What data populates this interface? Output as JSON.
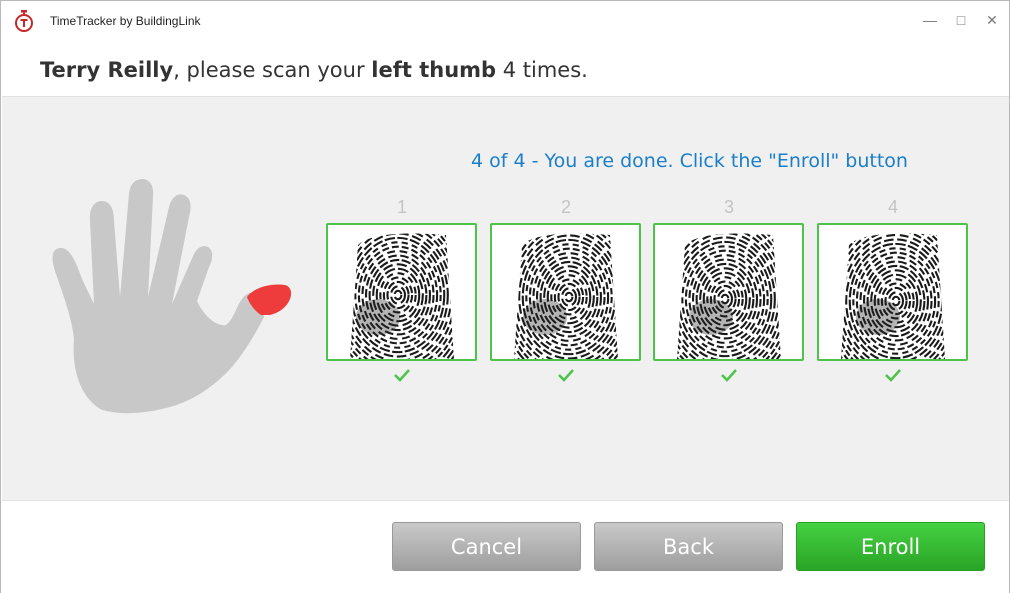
{
  "window": {
    "title": "TimeTracker by BuildingLink",
    "controls": {
      "minimize": "—",
      "maximize": "□",
      "close": "✕"
    }
  },
  "prompt": {
    "name": "Terry Reilly",
    "middle": ", please scan your ",
    "finger": "left thumb",
    "tail": " 4 times."
  },
  "status": {
    "text": "4 of 4 - You are done. Click the \"Enroll\" button"
  },
  "scans": [
    {
      "number": "1",
      "status": "check-icon"
    },
    {
      "number": "2",
      "status": "check-icon"
    },
    {
      "number": "3",
      "status": "check-icon"
    },
    {
      "number": "4",
      "status": "check-icon"
    }
  ],
  "footer": {
    "cancel_label": "Cancel",
    "back_label": "Back",
    "enroll_label": "Enroll"
  },
  "colors": {
    "accent_text": "#1a7fc8",
    "success_green": "#4cc44a",
    "highlight_finger": "#ee3b3b",
    "hand_gray": "#c8c8c8"
  }
}
